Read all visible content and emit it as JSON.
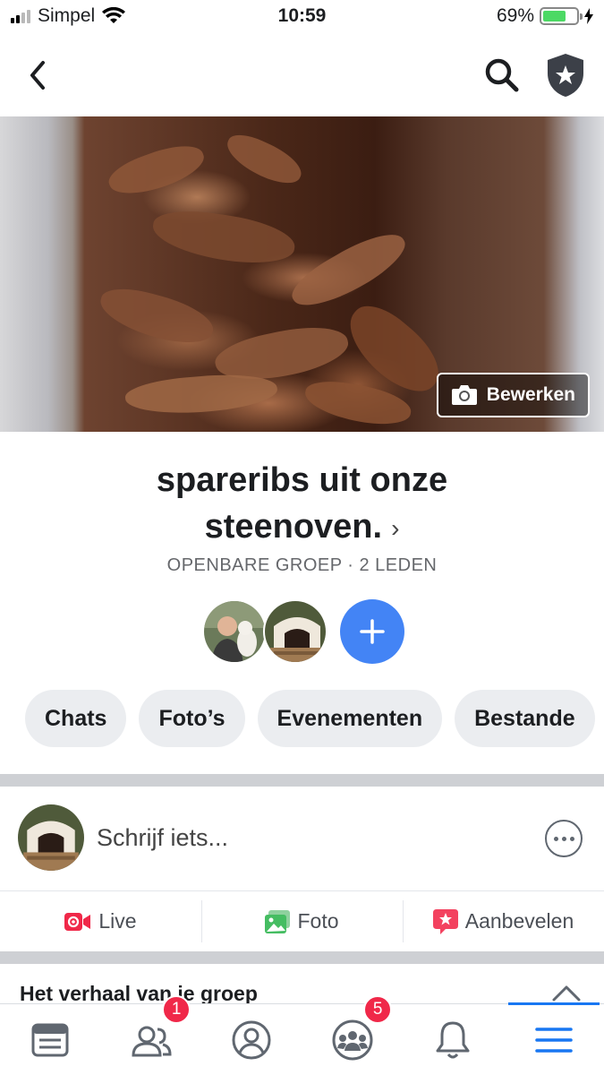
{
  "status_bar": {
    "carrier": "Simpel",
    "time": "10:59",
    "battery_percent": "69%",
    "battery_level": 0.69,
    "signal_bars": 2
  },
  "navbar": {
    "back_icon": "chevron-left-icon",
    "search_icon": "search-icon",
    "admin_icon": "shield-star-icon"
  },
  "cover": {
    "edit_label": "Bewerken",
    "edit_icon": "camera-icon"
  },
  "group": {
    "title": "spareribs uit onze steenoven.",
    "chevron": "›",
    "meta": "OPENBARE GROEP · 2 LEDEN"
  },
  "pills": [
    "Chats",
    "Foto’s",
    "Evenementen",
    "Bestande"
  ],
  "composer": {
    "placeholder": "Schrijf iets..."
  },
  "actions": [
    {
      "label": "Live",
      "icon": "live-video-icon",
      "color": "#f02849"
    },
    {
      "label": "Foto",
      "icon": "photo-icon",
      "color": "#45bd62"
    },
    {
      "label": "Aanbevelen",
      "icon": "recommend-icon",
      "color": "#f3425f"
    }
  ],
  "story": {
    "heading": "Het verhaal van je groep"
  },
  "tabbar": {
    "tabs": [
      {
        "icon": "news-feed-icon",
        "badge": ""
      },
      {
        "icon": "friends-icon",
        "badge": "1"
      },
      {
        "icon": "profile-icon",
        "badge": ""
      },
      {
        "icon": "groups-icon",
        "badge": "5"
      },
      {
        "icon": "bell-icon",
        "badge": ""
      },
      {
        "icon": "menu-icon",
        "badge": ""
      }
    ]
  },
  "colors": {
    "accent": "#1877f2",
    "add_button": "#4384f5",
    "badge": "#f02849",
    "pill_bg": "#ebedf0"
  }
}
